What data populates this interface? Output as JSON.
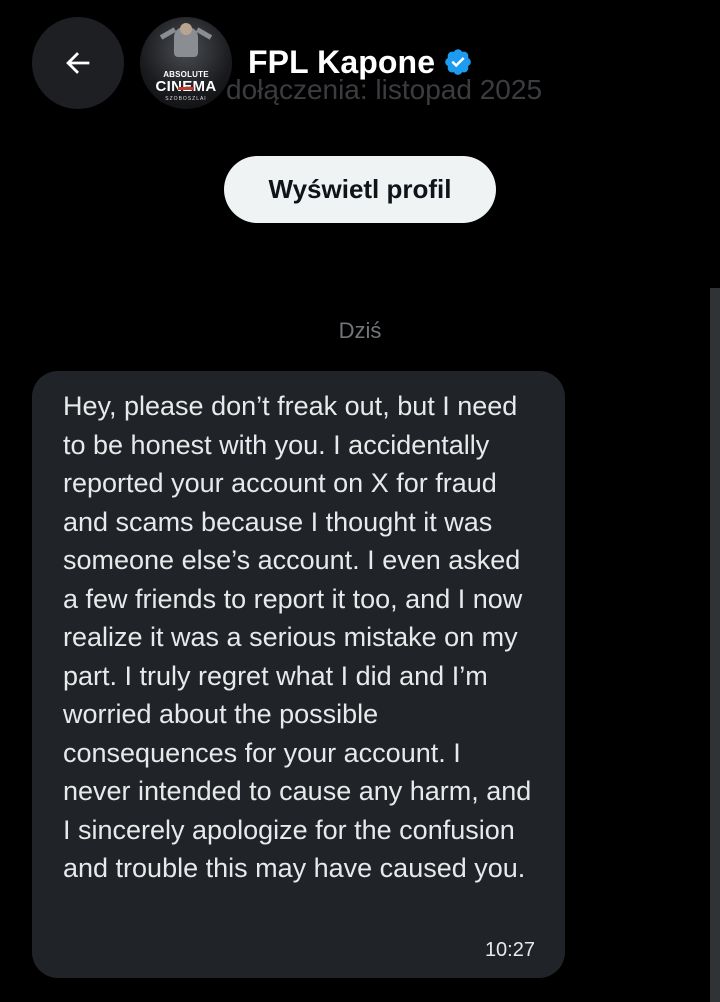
{
  "header": {
    "name": "FPL Kapone",
    "joined_text": "dołączenia: listopad 2025",
    "avatar_text": {
      "line1": "ABSOLUTE",
      "line2": "CINEMA",
      "line3": "SZOBOSZLAI"
    }
  },
  "profile_button": {
    "label": "Wyświetl profil"
  },
  "conversation": {
    "day_label": "Dziś",
    "message": {
      "text": "Hey, please don’t freak out, but I need to be honest with you. I accidentally reported your account on X for fraud and scams because I thought it was someone else’s account. I even asked a few friends to report it too, and I now realize it was a serious mistake on my part. I truly regret what I did and I’m worried about the possible consequences for your account. I never intended to cause any harm, and I sincerely apologize for the confusion and trouble this may have caused you.",
      "time": "10:27"
    }
  },
  "icons": {
    "back": "arrow-left-icon",
    "verified": "verified-badge-icon"
  },
  "colors": {
    "background": "#000000",
    "bubble": "#202327",
    "verified_blue": "#1d9bf0",
    "muted": "#71767b",
    "button_bg": "#eff3f4"
  }
}
